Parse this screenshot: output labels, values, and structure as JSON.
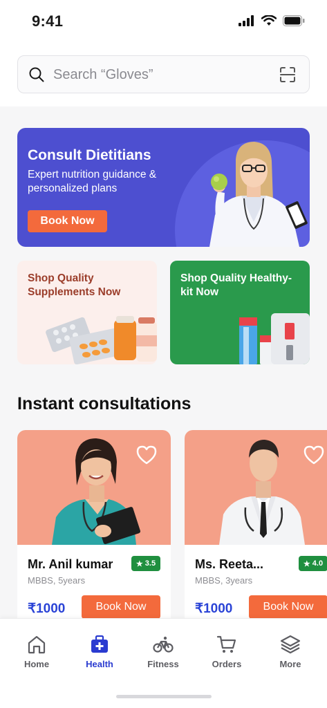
{
  "status_bar": {
    "time": "9:41"
  },
  "search": {
    "placeholder": "Search “Gloves”"
  },
  "banner": {
    "title": "Consult Dietitians",
    "subtitle": "Expert nutrition guidance & personalized plans",
    "button_label": "Book Now"
  },
  "promos": [
    {
      "title": "Shop Quality Supplements Now"
    },
    {
      "title": "Shop Quality Healthy-kit Now"
    }
  ],
  "consultations": {
    "title": "Instant consultations",
    "doctors": [
      {
        "name": "Mr. Anil kumar",
        "rating": "3.5",
        "meta": "MBBS, 5years",
        "price": "₹1000",
        "button_label": "Book Now"
      },
      {
        "name": "Ms. Reeta...",
        "rating": "4.0",
        "meta": "MBBS, 3years",
        "price": "₹1000",
        "button_label": "Book Now"
      }
    ]
  },
  "nav": {
    "items": [
      {
        "label": "Home",
        "icon": "home-icon"
      },
      {
        "label": "Health",
        "icon": "medical-kit-icon",
        "active": true
      },
      {
        "label": "Fitness",
        "icon": "bicycle-icon"
      },
      {
        "label": "Orders",
        "icon": "cart-icon"
      },
      {
        "label": "More",
        "icon": "layers-icon"
      }
    ]
  },
  "colors": {
    "accent_orange": "#f36a3c",
    "banner_purple": "#4d4fd0",
    "promo_green": "#2a9a4c",
    "price_blue": "#2a43d6",
    "nav_active": "#2a3bd0",
    "rating_green": "#1f8f3f",
    "doctor_bg": "#f4a088"
  }
}
